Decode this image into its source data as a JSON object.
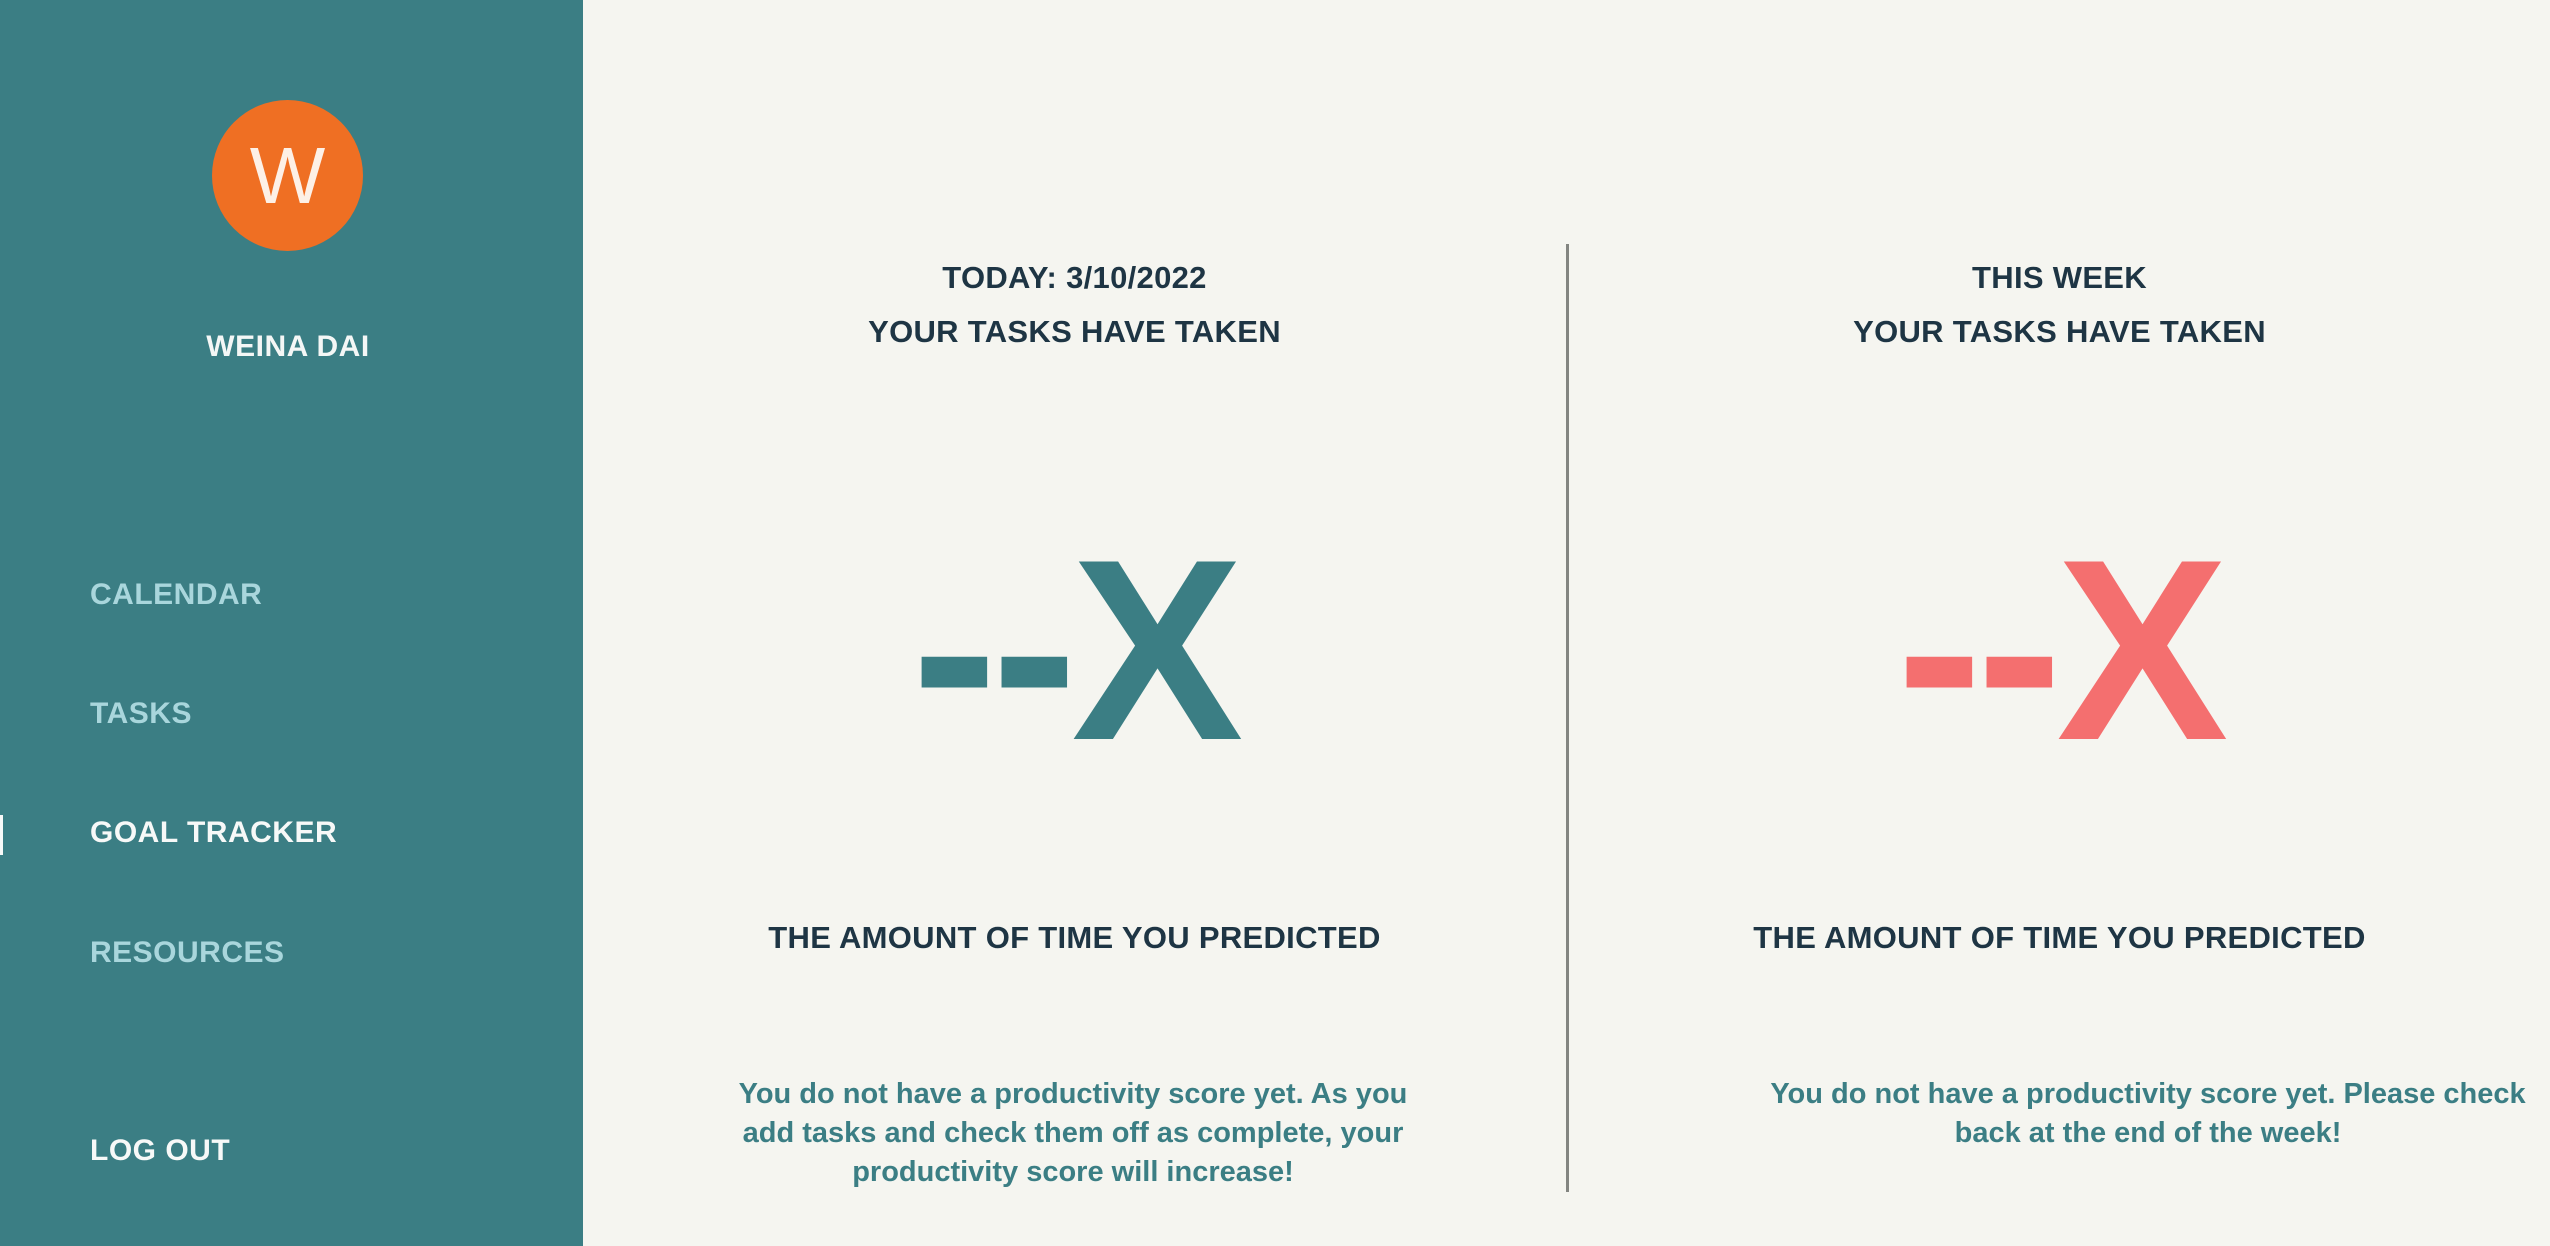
{
  "sidebar": {
    "avatar_initial": "W",
    "user_name": "WEINA DAI",
    "nav": {
      "calendar": "CALENDAR",
      "tasks": "TASKS",
      "goal_tracker": "GOAL TRACKER",
      "resources": "RESOURCES"
    },
    "active_item": "GOAL TRACKER",
    "logout_label": "LOG OUT"
  },
  "today": {
    "date_heading": "TODAY: 3/10/2022",
    "taken_heading": "YOUR TASKS HAVE TAKEN",
    "ratio": "--X",
    "predicted_heading": "THE AMOUNT OF TIME YOU PREDICTED",
    "message": "You do not have a productivity score yet. As you add tasks and check them off as complete, your productivity score will increase!"
  },
  "week": {
    "period_heading": "THIS WEEK",
    "taken_heading": "YOUR TASKS HAVE TAKEN",
    "ratio": "--X",
    "predicted_heading": "THE AMOUNT OF TIME YOU PREDICTED",
    "message": "You do not have a productivity score yet. Please check back at the end of the week!"
  },
  "colors": {
    "sidebar_bg": "#3b7e84",
    "avatar_bg": "#ef6f23",
    "page_bg": "#f5f5f0",
    "heading_text": "#1e3544",
    "today_ratio": "#3b7e84",
    "week_ratio": "#f46f6f",
    "nav_inactive": "#a9d6dc",
    "nav_active": "#f7f9f8"
  }
}
